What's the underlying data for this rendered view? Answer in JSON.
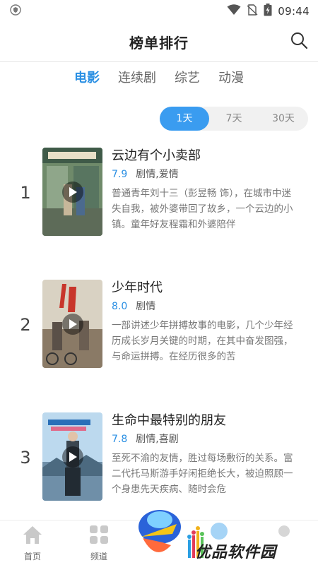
{
  "status_bar": {
    "time": "09:44"
  },
  "header": {
    "title": "榜单排行"
  },
  "category_tabs": [
    {
      "label": "电影",
      "active": true
    },
    {
      "label": "连续剧",
      "active": false
    },
    {
      "label": "综艺",
      "active": false
    },
    {
      "label": "动漫",
      "active": false
    }
  ],
  "period_tabs": [
    {
      "label": "1天",
      "active": true
    },
    {
      "label": "7天",
      "active": false
    },
    {
      "label": "30天",
      "active": false
    }
  ],
  "movies": [
    {
      "rank": "1",
      "title": "云边有个小卖部",
      "score": "7.9",
      "genre": "剧情,爱情",
      "desc": "普通青年刘十三（彭昱畅 饰），在城市中迷失自我，被外婆带回了故乡，一个云边的小镇。童年好友程霜和外婆陪伴"
    },
    {
      "rank": "2",
      "title": "少年时代",
      "score": "8.0",
      "genre": "剧情",
      "desc": "一部讲述少年拼搏故事的电影，几个少年经历成长岁月关键的时期，在其中奋发图强，与命运拼搏。在经历很多的苦"
    },
    {
      "rank": "3",
      "title": "生命中最特别的朋友",
      "score": "7.8",
      "genre": "剧情,喜剧",
      "desc": "至死不渝的友情，胜过每场敷衍的关系。富二代托马斯游手好闲拒绝长大，被迫照顾一个身患先天疾病、随时会危"
    }
  ],
  "bottom_nav": [
    {
      "label": "首页",
      "icon": "home-icon"
    },
    {
      "label": "频道",
      "icon": "grid-icon"
    }
  ],
  "watermark": {
    "text": "优品软件园"
  },
  "colors": {
    "accent": "#2a8fe3",
    "toggle_active": "#3a9cf0"
  }
}
